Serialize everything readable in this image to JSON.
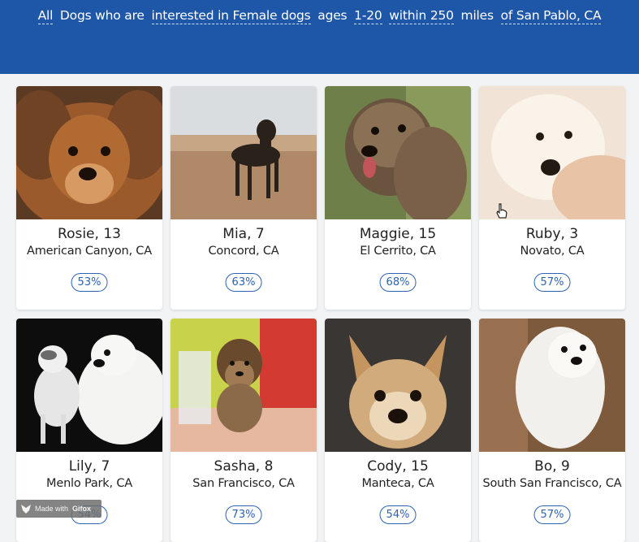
{
  "filter": {
    "all": "All",
    "dogs_who_are": "Dogs who are",
    "interest": "interested in Female dogs",
    "ages_label": "ages",
    "ages": "1-20",
    "within": "within 250",
    "miles_label": "miles",
    "location": "of San Pablo, CA"
  },
  "dogs": [
    {
      "name": "Rosie, 13",
      "location": "American Canyon, CA",
      "match": "53%",
      "photo_icon": "dog-photo-rosie"
    },
    {
      "name": "Mia, 7",
      "location": "Concord, CA",
      "match": "63%",
      "photo_icon": "dog-photo-mia"
    },
    {
      "name": "Maggie, 15",
      "location": "El Cerrito, CA",
      "match": "68%",
      "photo_icon": "dog-photo-maggie"
    },
    {
      "name": "Ruby, 3",
      "location": "Novato, CA",
      "match": "57%",
      "photo_icon": "dog-photo-ruby"
    },
    {
      "name": "Lily, 7",
      "location": "Menlo Park, CA",
      "match": "54%",
      "photo_icon": "dog-photo-lily"
    },
    {
      "name": "Sasha, 8",
      "location": "San Francisco, CA",
      "match": "73%",
      "photo_icon": "dog-photo-sasha"
    },
    {
      "name": "Cody, 15",
      "location": "Manteca, CA",
      "match": "54%",
      "photo_icon": "dog-photo-cody"
    },
    {
      "name": "Bo, 9",
      "location": "South San Francisco, CA",
      "match": "57%",
      "photo_icon": "dog-photo-bo"
    }
  ],
  "watermark": {
    "made_with": "Made with",
    "brand": "Gifox"
  },
  "colors": {
    "header": "#1f57a8",
    "accent": "#2d62b5",
    "background": "#f2f3f5"
  }
}
